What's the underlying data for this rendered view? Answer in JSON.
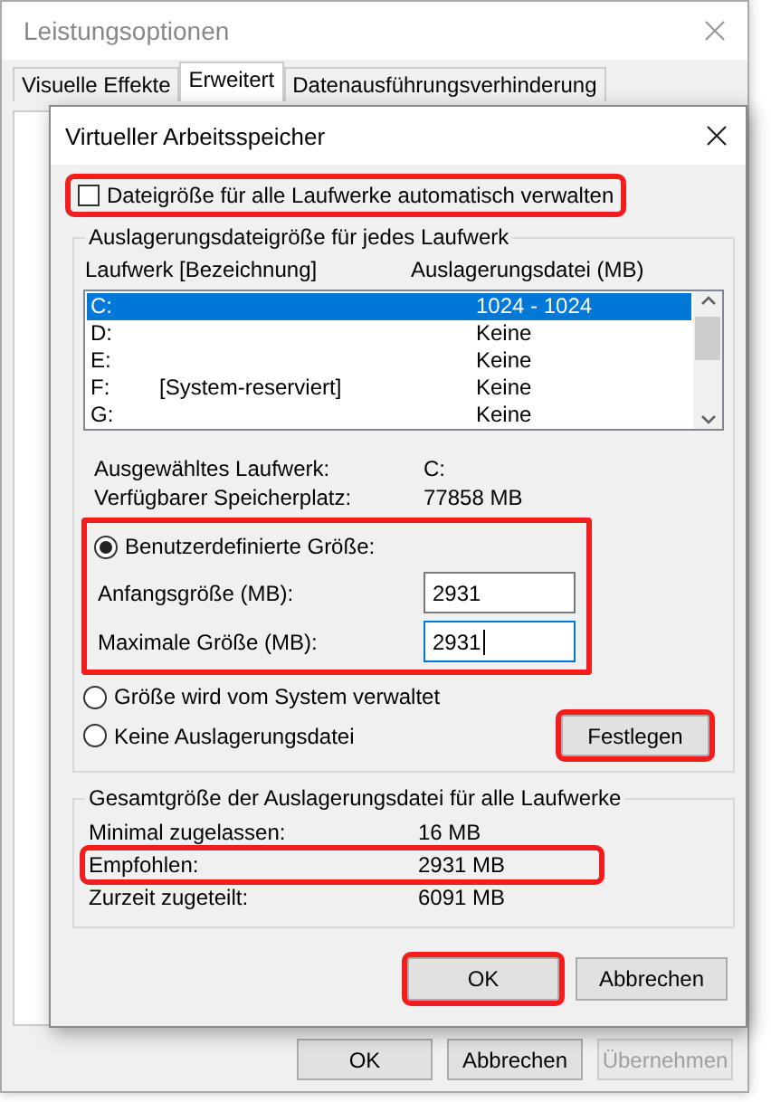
{
  "back_window": {
    "title": "Leistungsoptionen",
    "tabs": [
      {
        "label": "Visuelle Effekte",
        "selected": false
      },
      {
        "label": "Erweitert",
        "selected": true
      },
      {
        "label": "Datenausführungsverhinderung",
        "selected": false
      }
    ],
    "buttons": [
      {
        "label": "OK",
        "disabled": false
      },
      {
        "label": "Abbrechen",
        "disabled": false
      },
      {
        "label": "Übernehmen",
        "disabled": true
      }
    ]
  },
  "dialog": {
    "title": "Virtueller Arbeitsspeicher",
    "auto_manage": {
      "label": "Dateigröße für alle Laufwerke automatisch verwalten",
      "checked": false,
      "highlighted": true
    },
    "drives_group": {
      "title": "Auslagerungsdateigröße für jedes Laufwerk",
      "columns": [
        "Laufwerk [Bezeichnung]",
        "Auslagerungsdatei (MB)"
      ],
      "rows": [
        {
          "drive": "C:",
          "size": "1024 - 1024",
          "selected": true
        },
        {
          "drive": "D:",
          "size": "Keine",
          "selected": false
        },
        {
          "drive": "E:",
          "size": "Keine",
          "selected": false
        },
        {
          "drive": "F:",
          "label": "[System-reserviert]",
          "size": "Keine",
          "selected": false
        },
        {
          "drive": "G:",
          "size": "Keine",
          "selected": false
        }
      ]
    },
    "info": [
      {
        "label": "Ausgewähltes Laufwerk:",
        "value": "C:"
      },
      {
        "label": "Verfügbarer Speicherplatz:",
        "value": "77858 MB"
      }
    ],
    "size_options": [
      {
        "kind": "custom",
        "label": "Benutzerdefinierte Größe:",
        "selected": true,
        "highlighted": true,
        "fields": [
          {
            "label": "Anfangsgröße (MB):",
            "value": "2931",
            "focused": false
          },
          {
            "label": "Maximale Größe (MB):",
            "value": "2931",
            "focused": true
          }
        ]
      },
      {
        "kind": "plain",
        "label": "Größe wird vom System verwaltet",
        "selected": false
      },
      {
        "kind": "plain",
        "label": "Keine Auslagerungsdatei",
        "selected": false
      }
    ],
    "set_button": {
      "label": "Festlegen",
      "highlighted": true
    },
    "totals_group": {
      "title": "Gesamtgröße der Auslagerungsdatei für alle Laufwerke",
      "rows": [
        {
          "label": "Minimal zugelassen:",
          "value": "16 MB",
          "highlighted": false
        },
        {
          "label": "Empfohlen:",
          "value": "2931 MB",
          "highlighted": true
        },
        {
          "label": "Zurzeit zugeteilt:",
          "value": "6091 MB",
          "highlighted": false
        }
      ]
    },
    "buttons": [
      {
        "label": "OK",
        "highlighted": true
      },
      {
        "label": "Abbrechen",
        "highlighted": false
      }
    ]
  }
}
